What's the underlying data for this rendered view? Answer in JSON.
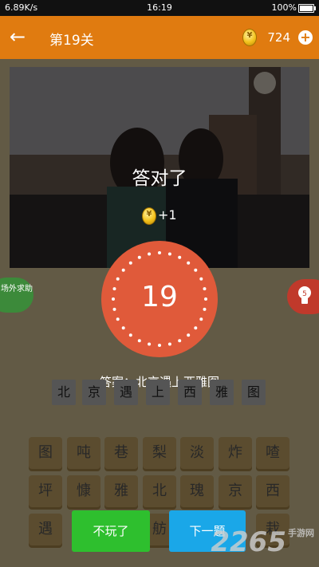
{
  "status": {
    "speed": "6.89K/s",
    "time": "16:19",
    "battery": "100%"
  },
  "header": {
    "title": "第19关",
    "coins": "724"
  },
  "side": {
    "help": "场外求助",
    "hint_count": "5"
  },
  "result": {
    "message": "答对了",
    "reward": "+1",
    "level": "19",
    "answer": "答案：北京遇上西雅图"
  },
  "slots": [
    "北",
    "京",
    "遇",
    "上",
    "西",
    "雅",
    "图"
  ],
  "grid": [
    [
      "图",
      "吨",
      "巷",
      "梨",
      "淡",
      "炸",
      "喳"
    ],
    [
      "坪",
      "慷",
      "雅",
      "北",
      "瑰",
      "京",
      "西"
    ],
    [
      "遇",
      "",
      "",
      "",
      "舫",
      "",
      "栽"
    ]
  ],
  "buttons": {
    "quit": "不玩了",
    "next": "下一题"
  },
  "watermark": {
    "brand": "2265",
    "sub": "手游网"
  },
  "colors": {
    "header": "#e07b10",
    "quit": "#2ebf2e",
    "next": "#1aa7e8",
    "badge": "#e05a3a"
  }
}
